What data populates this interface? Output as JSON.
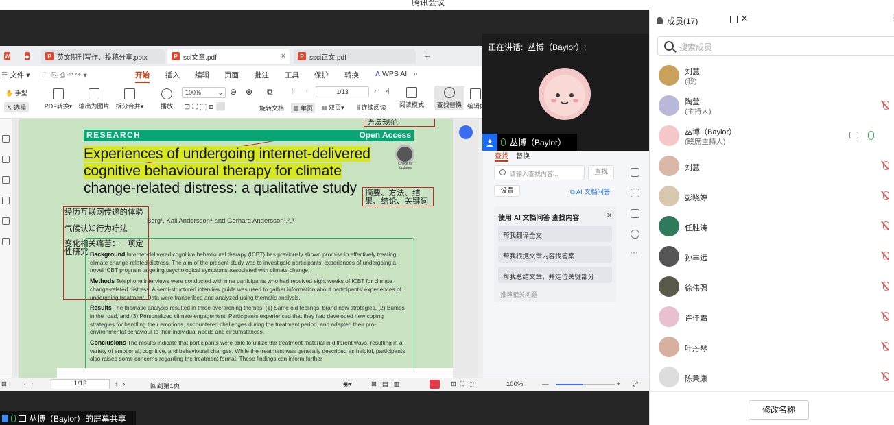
{
  "window": {
    "title": "腾讯会议"
  },
  "wps": {
    "tabs": [
      {
        "label": "英文期刊写作、投稿分享.pptx",
        "color": "#e0452d",
        "glyph": "P"
      },
      {
        "label": "sci文章.pdf",
        "color": "#e0452d",
        "glyph": "P"
      },
      {
        "label": "ssci正文.pdf",
        "color": "#e0452d",
        "glyph": "P"
      }
    ],
    "menu": {
      "file": "文件",
      "start": "开始",
      "insert": "插入",
      "edit": "编辑",
      "page": "页面",
      "annotate": "批注",
      "tools": "工具",
      "protect": "保护",
      "convert": "转换",
      "wps_ai": "WPS AI"
    },
    "ribbon": {
      "hand": "手型",
      "select": "选择",
      "pdf_convert": "PDF转换",
      "export_img": "输出为图片",
      "split_merge": "拆分合并",
      "play": "播放",
      "zoom": "100%",
      "page_input": "1/13",
      "rotate_doc": "旋转文档",
      "single_page": "单页",
      "double_page": "双页",
      "continuous": "连续阅读",
      "reading_mode": "阅读模式",
      "find_replace": "查找替换",
      "edit_content": "编辑内"
    },
    "doc": {
      "research": "RESEARCH",
      "open_access": "Open Access",
      "check_updates": "Check for updates",
      "title_lines": [
        "Experiences of undergoing internet-delivered",
        "cognitive behavioural therapy for climate",
        "change-related distress: a qualitative study"
      ],
      "authors": "Berg¹, Kali Andersson⁴ and Gerhard Andersson¹,²,³",
      "annotations": {
        "top": "语法规范",
        "summary": "摘要、方法、结果、结论、关键词",
        "t1": "经历互联网传递的体验",
        "t2": "气候认知行为疗法",
        "t3": "变化相关痛苦：一项定性研究"
      },
      "abstract": [
        {
          "head": "Background",
          "text": "Internet-delivered cognitive behavioural therapy (ICBT) has previously shown promise in effectively treating climate change-related distress. The aim of the present study was to investigate participants' experiences of undergoing a novel ICBT program targeting psychological symptoms associated with climate change."
        },
        {
          "head": "Methods",
          "text": "Telephone interviews were conducted with nine participants who had received eight weeks of ICBT for climate change-related distress. A semi-structured interview guide was used to gather information about participants' experiences of undergoing treatment. Data were transcribed and analyzed using thematic analysis."
        },
        {
          "head": "Results",
          "text": "The thematic analysis resulted in three overarching themes: (1) Same old feelings, brand new strategies, (2) Bumps in the road, and (3) Personalized climate engagement. Participants experienced that they had developed new coping strategies for handling their emotions, encountered challenges during the treatment period, and adapted their pro-environmental behaviour to their individual needs and circumstances."
        },
        {
          "head": "Conclusions",
          "text": "The results indicate that participants were able to utilize the treatment material in different ways, resulting in a variety of emotional, cognitive, and behavioural changes. While the treatment was generally described as helpful, participants also raised some concerns regarding the treatment format. These findings can inform further"
        }
      ]
    },
    "find_panel": {
      "tab_find": "查找",
      "tab_replace": "替换",
      "placeholder": "请输入查找内容...",
      "find_btn": "查找",
      "settings": "设置",
      "ai_link": "AI 文档问答",
      "ai_title": "使用 AI 文档问答 查找内容",
      "suggestions": [
        "帮我翻译全文",
        "帮我根据文章内容找答案",
        "帮我总结文章，并定位关键部分"
      ],
      "recommend": "推荐相关问题"
    },
    "status": {
      "page": "1/13",
      "back": "回到第1页",
      "zoom": "100%"
    }
  },
  "speaker": {
    "label": "正在讲话:",
    "name": "丛博（Baylor）;",
    "tag": "丛博（Baylor）"
  },
  "share": {
    "label": "丛博（Baylor）的屏幕共享"
  },
  "members": {
    "title": "成员(17)",
    "search_placeholder": "搜索成员",
    "list": [
      {
        "name": "刘慧",
        "role": "(我)",
        "avatar": "#c9a15a",
        "mic": "none"
      },
      {
        "name": "陶莹",
        "role": "(主持人)",
        "avatar": "#b8b8d8",
        "mic": "off"
      },
      {
        "name": "丛博（Baylor）",
        "role": "(联席主持人)",
        "avatar": "#f4c7c8",
        "mic": "on"
      },
      {
        "name": "刘慧",
        "role": "",
        "avatar": "#d9b8a8",
        "mic": "off"
      },
      {
        "name": "彭晓婷",
        "role": "",
        "avatar": "#d8c8b0",
        "mic": "off"
      },
      {
        "name": "任胜涛",
        "role": "",
        "avatar": "#2e7a5a",
        "mic": "off"
      },
      {
        "name": "孙丰远",
        "role": "",
        "avatar": "#555555",
        "mic": "off"
      },
      {
        "name": "徐伟强",
        "role": "",
        "avatar": "#5a5a4a",
        "mic": "off"
      },
      {
        "name": "许佳霜",
        "role": "",
        "avatar": "#e8c0d0",
        "mic": "off"
      },
      {
        "name": "叶丹琴",
        "role": "",
        "avatar": "#d8b0a0",
        "mic": "off"
      },
      {
        "name": "陈秉康",
        "role": "",
        "avatar": "#dddddd",
        "mic": "off"
      }
    ],
    "rename_button": "修改名称"
  }
}
